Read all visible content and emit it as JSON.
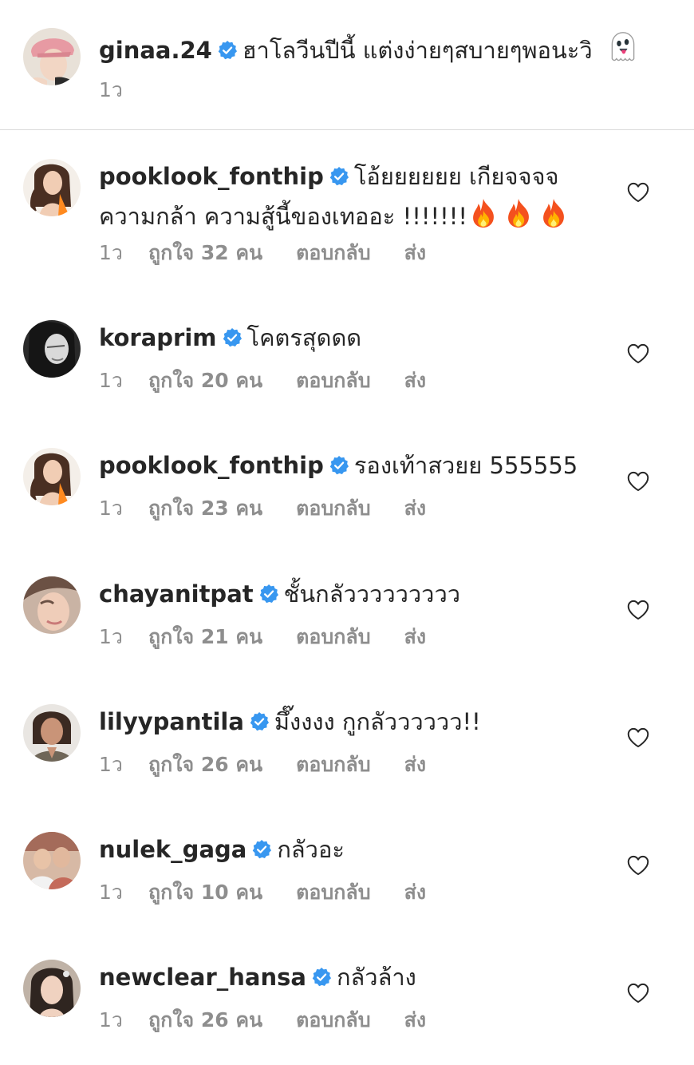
{
  "caption": {
    "username": "ginaa.24",
    "text": "ฮาโลวีนปีนี้ แต่งง่ายๆสบายๆพอนะวิ",
    "emoji": "ghost-emoji",
    "time": "1ว"
  },
  "meta_labels": {
    "reply": "ตอบกลับ",
    "send": "ส่ง"
  },
  "comments": [
    {
      "username": "pooklook_fonthip",
      "line1": "โอ้ยยยยยย เกียจจจจ",
      "line2": "ความกล้า ความสู้นี้ของเทออะ !!!!!!!",
      "emoji": "fire-emoji x3",
      "time": "1ว",
      "likes": "ถูกใจ 32 คน"
    },
    {
      "username": "koraprim",
      "text": "โคตรสุดดด",
      "time": "1ว",
      "likes": "ถูกใจ 20 คน"
    },
    {
      "username": "pooklook_fonthip",
      "text": "รองเท้าสวยย 555555",
      "time": "1ว",
      "likes": "ถูกใจ 23 คน"
    },
    {
      "username": "chayanitpat",
      "text": "ชั้นกลัววววววววว",
      "time": "1ว",
      "likes": "ถูกใจ 21 คน"
    },
    {
      "username": "lilyypantila",
      "text": "มึ๊งงงง กูกลัวววววว!!",
      "time": "1ว",
      "likes": "ถูกใจ 26 คน"
    },
    {
      "username": "nulek_gaga",
      "text": "กลัวอะ",
      "time": "1ว",
      "likes": "ถูกใจ 10 คน"
    },
    {
      "username": "newclear_hansa",
      "text": "กลัวล้าง",
      "time": "1ว",
      "likes": "ถูกใจ 26 คน"
    }
  ],
  "colors": {
    "verified": "#3897f0",
    "text": "#262626",
    "secondary": "#8e8e8e",
    "divider": "#dbdbdb"
  }
}
